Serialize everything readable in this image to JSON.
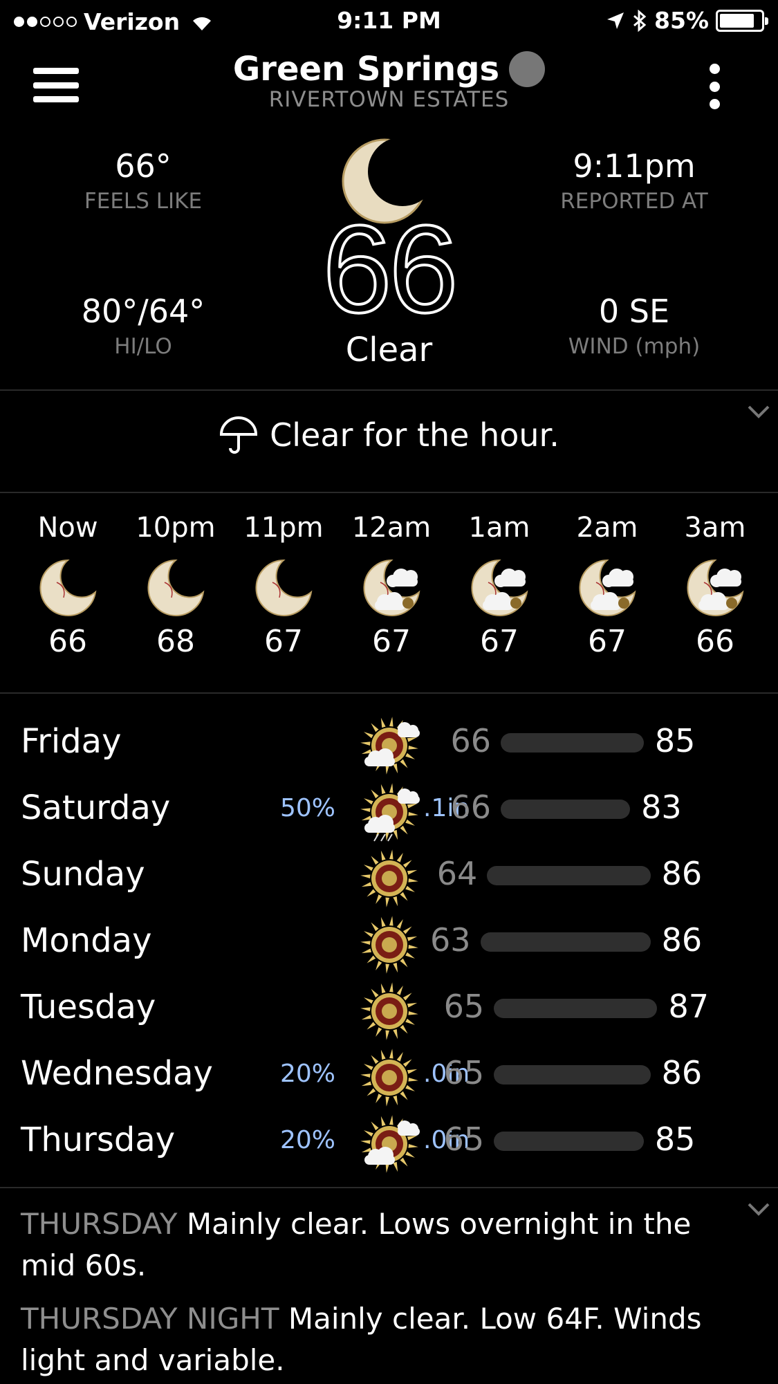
{
  "status_bar": {
    "carrier": "Verizon",
    "time": "9:11 PM",
    "battery": "85%",
    "battery_level": 0.85,
    "signal_bars_on": 2,
    "signal_bars_total": 5
  },
  "header": {
    "city": "Green Springs",
    "neighborhood": "RIVERTOWN ESTATES"
  },
  "current": {
    "feels_like_value": "66°",
    "feels_like_label": "FEELS LIKE",
    "reported_value": "9:11pm",
    "reported_label": "REPORTED AT",
    "hilo_value": "80°/64°",
    "hilo_label": "HI/LO",
    "wind_value": "0 SE",
    "wind_label": "WIND (mph)",
    "temperature": "66",
    "condition": "Clear",
    "icon": "moon-icon"
  },
  "minutely": {
    "summary": "Clear for the hour.",
    "icon": "umbrella-icon"
  },
  "hourly": [
    {
      "time": "Now",
      "temp": "66",
      "icon": "moon"
    },
    {
      "time": "10pm",
      "temp": "68",
      "icon": "moon"
    },
    {
      "time": "11pm",
      "temp": "67",
      "icon": "moon"
    },
    {
      "time": "12am",
      "temp": "67",
      "icon": "moon-cloud"
    },
    {
      "time": "1am",
      "temp": "67",
      "icon": "moon-cloud"
    },
    {
      "time": "2am",
      "temp": "67",
      "icon": "moon-cloud"
    },
    {
      "time": "3am",
      "temp": "66",
      "icon": "moon-cloud"
    }
  ],
  "daily": [
    {
      "day": "Friday",
      "pop": "",
      "amount": "",
      "low": "66",
      "high": "85",
      "icon": "sun-cloud"
    },
    {
      "day": "Saturday",
      "pop": "50%",
      "amount": ".1in",
      "low": "66",
      "high": "83",
      "icon": "sun-storm"
    },
    {
      "day": "Sunday",
      "pop": "",
      "amount": "",
      "low": "64",
      "high": "86",
      "icon": "sun"
    },
    {
      "day": "Monday",
      "pop": "",
      "amount": "",
      "low": "63",
      "high": "86",
      "icon": "sun"
    },
    {
      "day": "Tuesday",
      "pop": "",
      "amount": "",
      "low": "65",
      "high": "87",
      "icon": "sun"
    },
    {
      "day": "Wednesday",
      "pop": "20%",
      "amount": ".0in",
      "low": "65",
      "high": "86",
      "icon": "sun"
    },
    {
      "day": "Thursday",
      "pop": "20%",
      "amount": ".0in",
      "low": "65",
      "high": "85",
      "icon": "sun-cloud"
    }
  ],
  "forecast_text": [
    {
      "period": "THURSDAY",
      "text": "Mainly clear. Lows overnight in the mid 60s."
    },
    {
      "period": "THURSDAY NIGHT",
      "text": "Mainly clear. Low 64F. Winds light and variable."
    }
  ],
  "colors": {
    "background": "#000000",
    "label_gray": "#8e8e8e",
    "precip_blue": "#9ec3ff",
    "bar_gray": "#2f2f2f"
  }
}
